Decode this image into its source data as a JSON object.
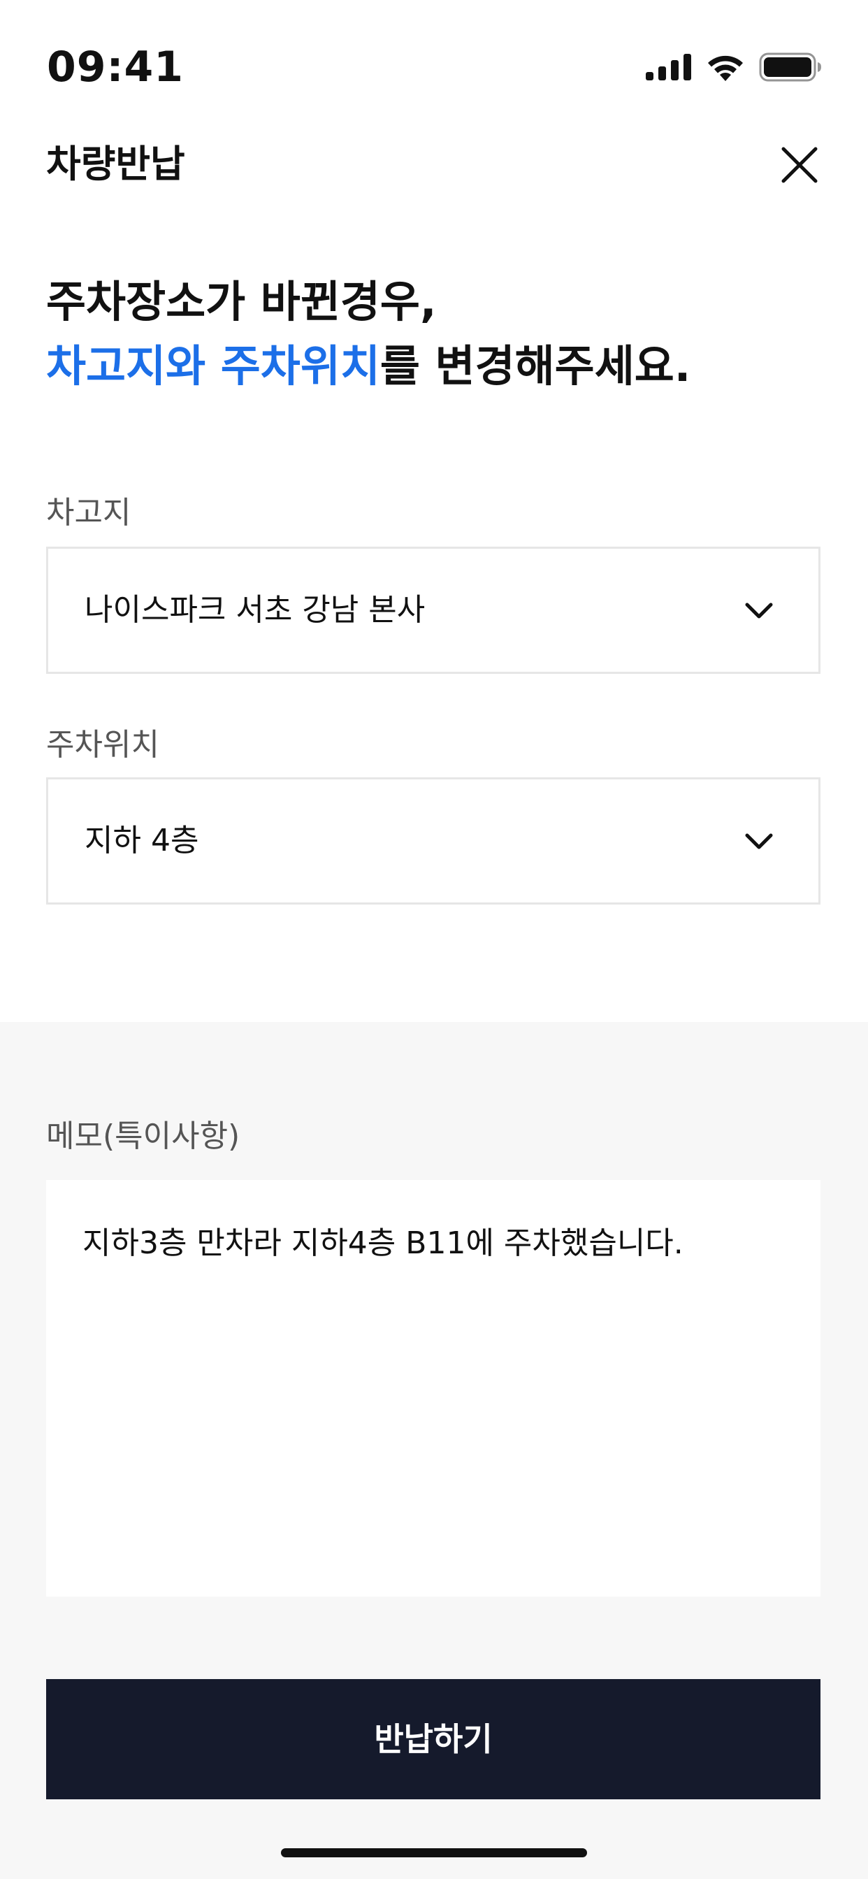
{
  "status_bar": {
    "time": "09:41",
    "icons": [
      "cellular-signal-icon",
      "wifi-icon",
      "battery-icon"
    ]
  },
  "header": {
    "title": "차량반납",
    "close_icon": "close-icon"
  },
  "headline": {
    "line1": "주차장소가 바뀐경우,",
    "line2_accent": "차고지와 주차위치",
    "line2_rest": "를 변경해주세요."
  },
  "garage": {
    "label": "차고지",
    "value": "나이스파크 서초 강남 본사"
  },
  "parking": {
    "label": "주차위치",
    "value": "지하 4층"
  },
  "memo": {
    "label": "메모(특이사항)",
    "value": "지하3층 만차라 지하4층 B11에 주차했습니다."
  },
  "submit": {
    "label": "반납하기"
  },
  "colors": {
    "accent": "#1c6fe8",
    "button_bg": "#151a2c",
    "memo_section_bg": "#f7f7f7"
  }
}
